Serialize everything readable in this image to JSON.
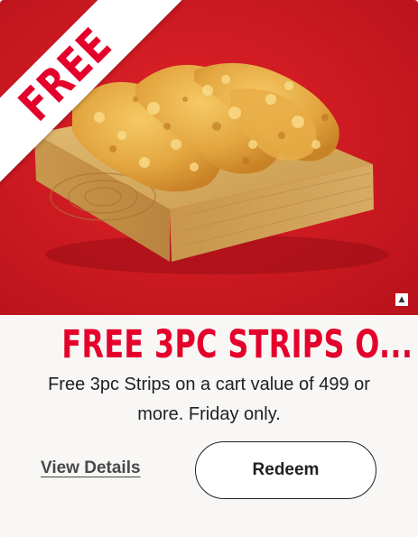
{
  "offer": {
    "ribbon_text": "FREE",
    "title": "FREE 3PC STRIPS O...",
    "description": "Free 3pc Strips on a cart value of 499 or more. Friday only.",
    "view_details_label": "View Details",
    "redeem_label": "Redeem",
    "image_subject": "Three fried chicken strips on a wooden board",
    "info_glyph": "▲"
  },
  "colors": {
    "brand_red": "#e4002b",
    "hero_background": "#cf1b22",
    "card_background": "#f8f7f5",
    "text_dark": "#202124"
  },
  "icons": [
    "info-triangle-icon"
  ]
}
